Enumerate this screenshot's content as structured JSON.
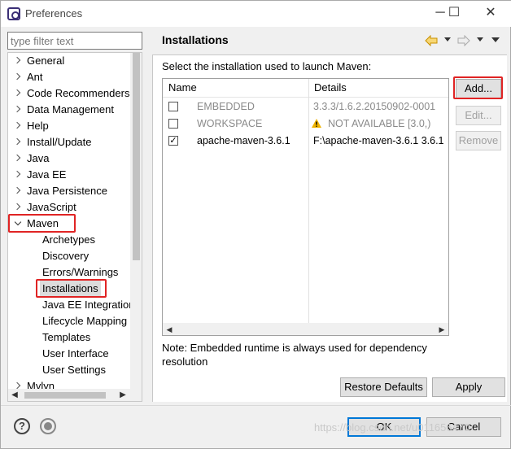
{
  "window": {
    "title": "Preferences",
    "minimize_glyph": "─",
    "maximize_glyph": "☐",
    "close_glyph": "✕"
  },
  "filter": {
    "placeholder": "type filter text"
  },
  "tree": [
    {
      "label": "General",
      "level": 0,
      "state": "closed"
    },
    {
      "label": "Ant",
      "level": 0,
      "state": "closed"
    },
    {
      "label": "Code Recommenders",
      "level": 0,
      "state": "closed"
    },
    {
      "label": "Data Management",
      "level": 0,
      "state": "closed"
    },
    {
      "label": "Help",
      "level": 0,
      "state": "closed"
    },
    {
      "label": "Install/Update",
      "level": 0,
      "state": "closed"
    },
    {
      "label": "Java",
      "level": 0,
      "state": "closed"
    },
    {
      "label": "Java EE",
      "level": 0,
      "state": "closed"
    },
    {
      "label": "Java Persistence",
      "level": 0,
      "state": "closed"
    },
    {
      "label": "JavaScript",
      "level": 0,
      "state": "closed"
    },
    {
      "label": "Maven",
      "level": 0,
      "state": "open"
    },
    {
      "label": "Archetypes",
      "level": 1
    },
    {
      "label": "Discovery",
      "level": 1
    },
    {
      "label": "Errors/Warnings",
      "level": 1
    },
    {
      "label": "Installations",
      "level": 1,
      "selected": true
    },
    {
      "label": "Java EE Integration",
      "level": 1
    },
    {
      "label": "Lifecycle Mapping",
      "level": 1
    },
    {
      "label": "Templates",
      "level": 1
    },
    {
      "label": "User Interface",
      "level": 1
    },
    {
      "label": "User Settings",
      "level": 1
    },
    {
      "label": "Mylyn",
      "level": 0,
      "state": "closed"
    }
  ],
  "page": {
    "title": "Installations",
    "intro": "Select the installation used to launch Maven:",
    "columns": [
      "Name",
      "Details"
    ],
    "rows": [
      {
        "checked": false,
        "name": "EMBEDDED",
        "details": "3.3.3/1.6.2.20150902-0001",
        "disabled": true
      },
      {
        "checked": false,
        "name": "WORKSPACE",
        "details": "NOT AVAILABLE [3.0,)",
        "disabled": true,
        "warning": true
      },
      {
        "checked": true,
        "name": "apache-maven-3.6.1",
        "details": "F:\\apache-maven-3.6.1 3.6.1",
        "disabled": false
      }
    ],
    "buttons": {
      "add": "Add...",
      "edit": "Edit...",
      "remove": "Remove"
    },
    "note": "Note: Embedded runtime is always used for dependency resolution",
    "restore_defaults": "Restore Defaults",
    "apply": "Apply"
  },
  "footer": {
    "ok": "OK",
    "cancel": "Cancel",
    "help_glyph": "?",
    "watermark": "https://blog.csdn.net/u011656470"
  },
  "icons": [
    "app-icon",
    "back-arrow-icon",
    "forward-arrow-icon",
    "menu-icon",
    "warning-icon",
    "help-icon",
    "record-icon"
  ],
  "colors": {
    "highlight": "#e02424",
    "warning": "#f0b400",
    "nav_arrow": "#d8a000"
  }
}
